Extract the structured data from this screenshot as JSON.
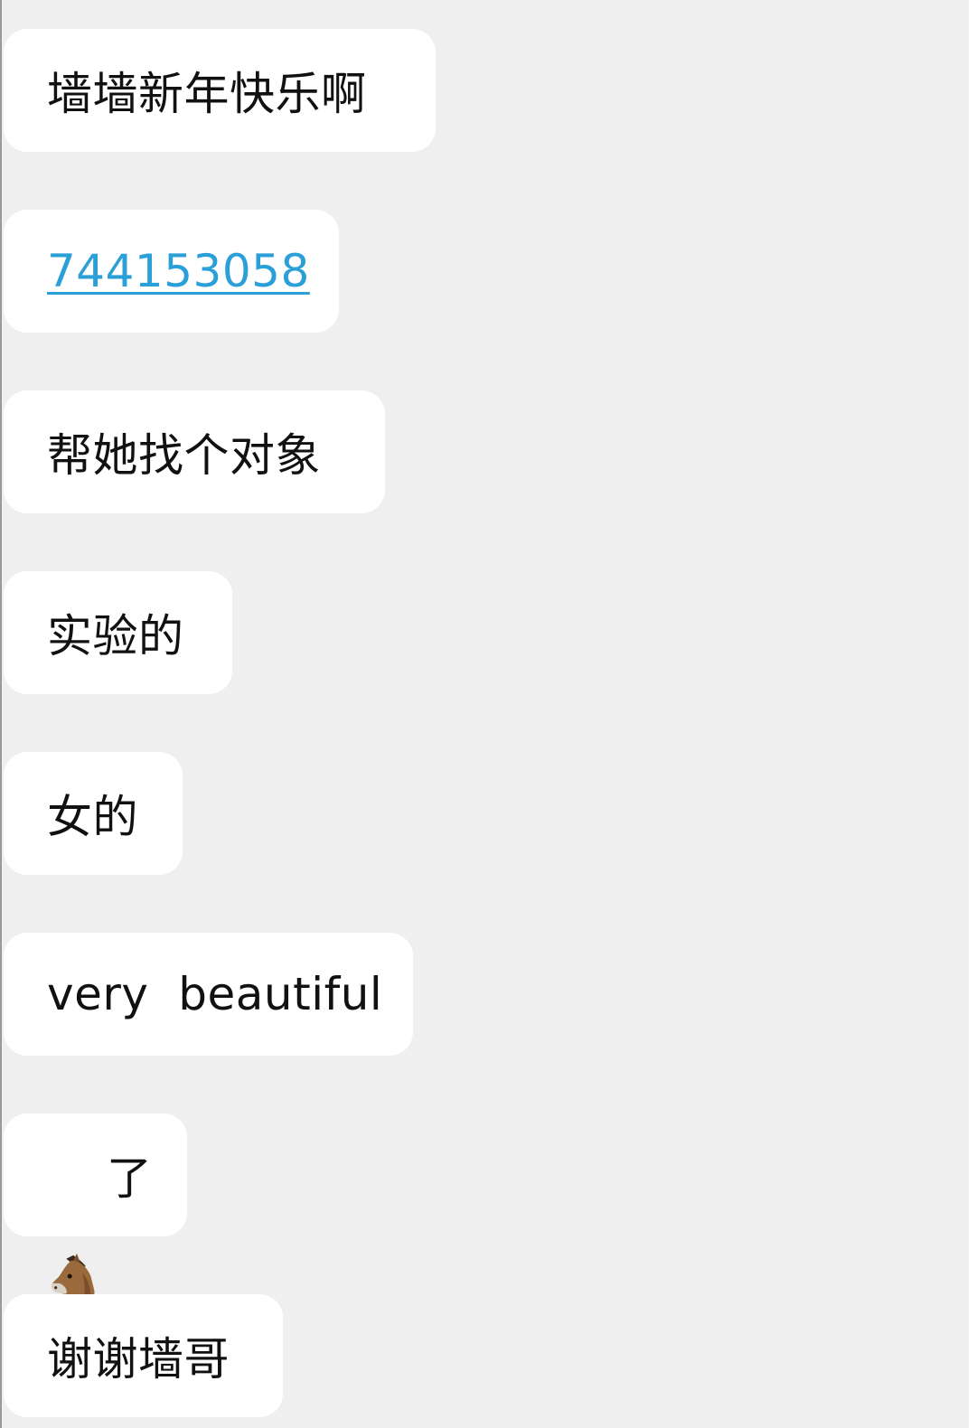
{
  "messages": [
    {
      "text": "墙墙新年快乐啊"
    },
    {
      "text": "744153058",
      "link": true
    },
    {
      "text": "帮她找个对象"
    },
    {
      "text": "实验的"
    },
    {
      "text": "女的"
    },
    {
      "text": "very  beautiful"
    },
    {
      "icon": "horse-face-icon",
      "text": "了"
    },
    {
      "text": "谢谢墙哥"
    }
  ],
  "colors": {
    "background": "#efefef",
    "bubble": "#ffffff",
    "text": "#111111",
    "link": "#2a9fd8"
  }
}
